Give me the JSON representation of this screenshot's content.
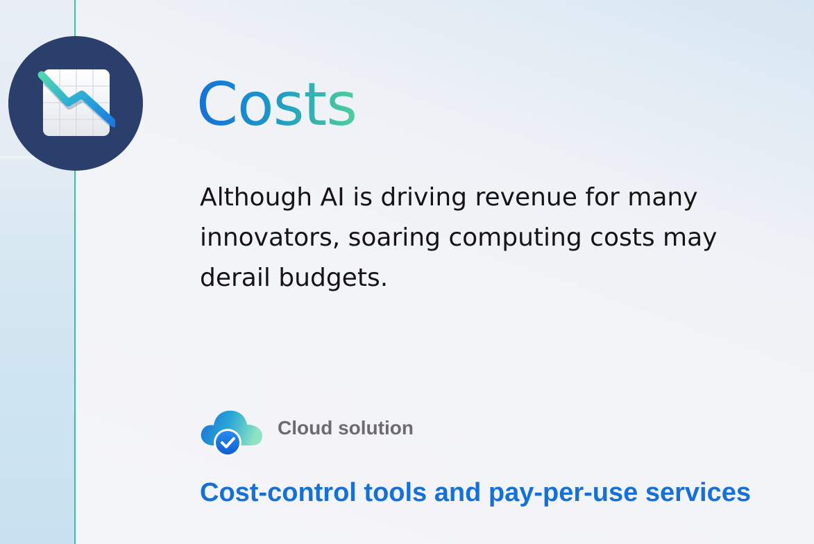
{
  "section": {
    "title": "Costs",
    "icon": "declining-chart-icon",
    "description": "Although AI is driving revenue for many innovators, soaring computing costs may derail budgets."
  },
  "solution": {
    "icon": "cloud-check-icon",
    "label": "Cloud solution",
    "heading": "Cost-control tools and pay-per-use services"
  },
  "colors": {
    "accent_blue": "#1570d8",
    "accent_green": "#4fcf9a",
    "timeline": "#37c4a0",
    "icon_circle": "#2a3f6b",
    "body_text": "#141414",
    "muted_text": "#6c6c6c"
  }
}
